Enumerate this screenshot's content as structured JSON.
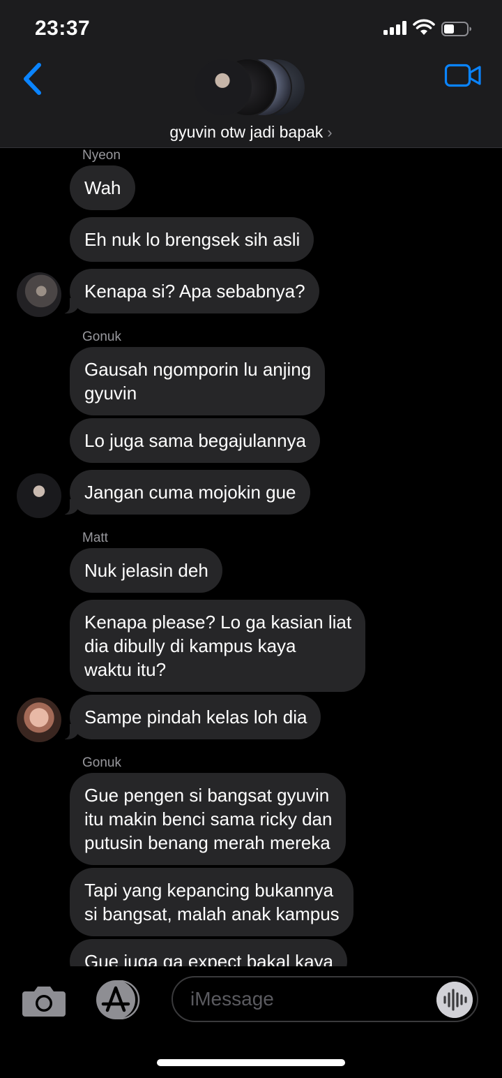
{
  "status_bar": {
    "time": "23:37"
  },
  "header": {
    "group_name": "gyuvin otw jadi bapak",
    "chevron": "›",
    "icons": {
      "back": "chevron-left-icon",
      "video": "video-camera-icon"
    },
    "accent_color": "#0a84ff"
  },
  "messages": [
    {
      "sender": "Nyeon",
      "bubbles": [
        "Wah",
        "Eh nuk lo brengsek sih asli",
        "Kenapa si? Apa sebabnya?"
      ]
    },
    {
      "sender": "Gonuk",
      "bubbles": [
        "Gausah ngomporin lu anjing\ngyuvin",
        "Lo juga sama begajulannya",
        "Jangan cuma mojokin gue"
      ]
    },
    {
      "sender": "Matt",
      "bubbles": [
        "Nuk jelasin deh",
        "Kenapa please? Lo ga kasian liat\ndia dibully di kampus kaya\nwaktu itu?",
        "Sampe pindah kelas loh dia"
      ]
    },
    {
      "sender": "Gonuk",
      "bubbles": [
        "Gue pengen si bangsat gyuvin\nitu makin benci sama ricky dan\nputusin benang merah mereka",
        "Tapi yang kepancing bukannya\nsi bangsat, malah anak kampus",
        "Gue juga ga expect bakal kaya"
      ]
    }
  ],
  "input_bar": {
    "placeholder": "iMessage",
    "icons": {
      "camera": "camera-icon",
      "apps": "app-store-icon",
      "audio": "audio-waveform-icon"
    }
  },
  "colors": {
    "bubble": "#262628",
    "header_bg": "#1c1c1e",
    "sender_name": "#98989d"
  }
}
